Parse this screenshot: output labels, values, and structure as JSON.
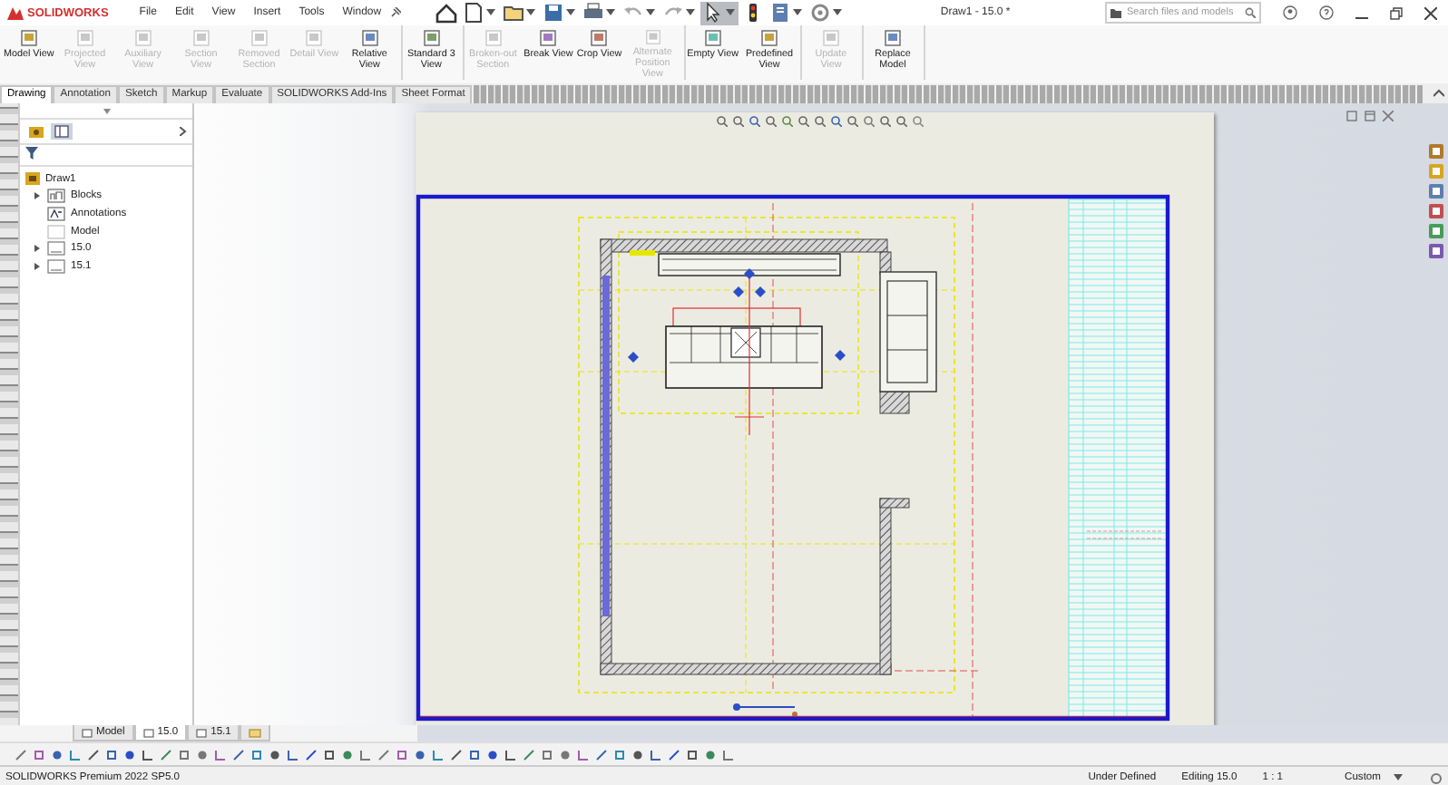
{
  "window": {
    "app": "SOLIDWORKS",
    "title": "Draw1 - 15.0 *"
  },
  "menu": [
    "File",
    "Edit",
    "View",
    "Insert",
    "Tools",
    "Window"
  ],
  "quick_access": [
    {
      "kind": "home",
      "selected": false
    },
    {
      "kind": "new",
      "selected": false
    },
    {
      "kind": "open",
      "selected": false
    },
    {
      "kind": "save",
      "selected": false
    },
    {
      "kind": "print",
      "selected": false
    },
    {
      "kind": "undo",
      "selected": false
    },
    {
      "kind": "redo",
      "selected": false
    },
    {
      "kind": "select",
      "selected": true
    },
    {
      "kind": "rebuild",
      "selected": false
    },
    {
      "kind": "properties",
      "selected": false
    },
    {
      "kind": "options",
      "selected": false
    }
  ],
  "search": {
    "placeholder": "Search files and models"
  },
  "ribbon": {
    "groups": [
      {
        "buttons": [
          {
            "label": "Model View",
            "disabled": false
          },
          {
            "label": "Projected View",
            "disabled": true
          },
          {
            "label": "Auxiliary View",
            "disabled": true
          },
          {
            "label": "Section View",
            "disabled": true
          },
          {
            "label": "Removed Section",
            "disabled": true
          },
          {
            "label": "Detail View",
            "disabled": true
          },
          {
            "label": "Relative View",
            "disabled": false
          }
        ]
      },
      {
        "buttons": [
          {
            "label": "Standard 3 View",
            "disabled": false
          }
        ]
      },
      {
        "buttons": [
          {
            "label": "Broken-out Section",
            "disabled": true
          },
          {
            "label": "Break View",
            "disabled": false
          },
          {
            "label": "Crop View",
            "disabled": false
          },
          {
            "label": "Alternate Position View",
            "disabled": true
          }
        ]
      },
      {
        "buttons": [
          {
            "label": "Empty View",
            "disabled": false
          },
          {
            "label": "Predefined View",
            "disabled": false
          }
        ]
      },
      {
        "buttons": [
          {
            "label": "Update View",
            "disabled": true
          }
        ]
      },
      {
        "buttons": [
          {
            "label": "Replace Model",
            "disabled": false
          }
        ]
      }
    ]
  },
  "command_tabs": [
    {
      "label": "Drawing",
      "selected": true
    },
    {
      "label": "Annotation",
      "selected": false
    },
    {
      "label": "Sketch",
      "selected": false
    },
    {
      "label": "Markup",
      "selected": false
    },
    {
      "label": "Evaluate",
      "selected": false
    },
    {
      "label": "SOLIDWORKS Add-Ins",
      "selected": false
    },
    {
      "label": "Sheet Format",
      "selected": false
    }
  ],
  "feature_tree": {
    "items": [
      {
        "label": "Draw1",
        "kind": "drawing",
        "children": [
          {
            "label": "Blocks",
            "kind": "folder",
            "expandable": true
          },
          {
            "label": "Annotations",
            "kind": "annotations",
            "expandable": false
          },
          {
            "label": "Model",
            "kind": "model",
            "expandable": false
          },
          {
            "label": "15.0",
            "kind": "sheet",
            "expandable": true
          },
          {
            "label": "15.1",
            "kind": "sheet",
            "expandable": true
          }
        ]
      }
    ]
  },
  "sheet_tabs": [
    {
      "label": "Model",
      "selected": false
    },
    {
      "label": "15.0",
      "selected": true
    },
    {
      "label": "15.1",
      "selected": false
    }
  ],
  "status_bar": {
    "product": "SOLIDWORKS Premium 2022 SP5.0",
    "state": "Under Defined",
    "editing": "Editing 15.0",
    "scale": "1 : 1",
    "units": "Custom"
  }
}
